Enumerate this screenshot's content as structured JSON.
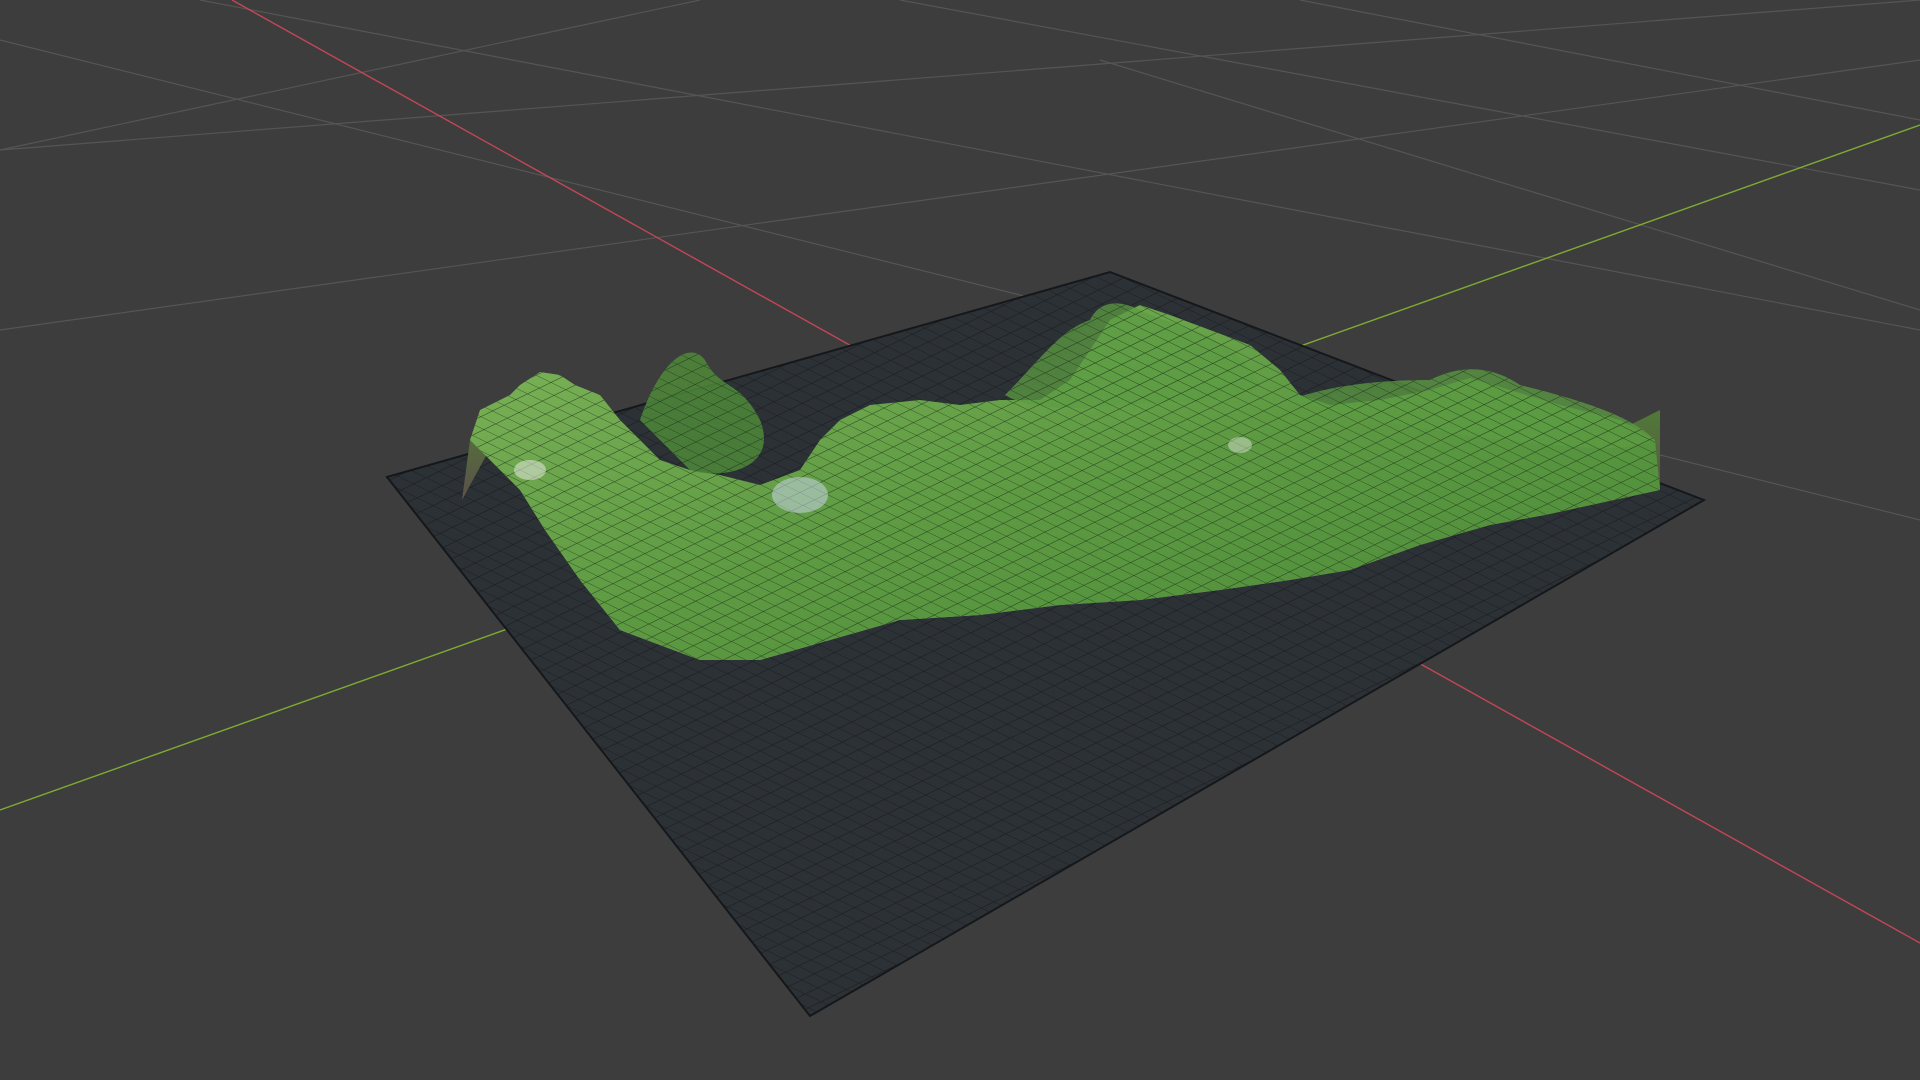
{
  "viewport": {
    "background_color": "#3d3d3d",
    "floor_grid_color": "#555555",
    "x_axis_color": "#d9485b",
    "y_axis_color": "#8bbd31"
  },
  "terrain": {
    "base_plane_color": "#2c3136",
    "base_plane_wire_color": "#1a1d20",
    "surface_color": "#5d9a42",
    "surface_light_color": "#8cc55a",
    "cliff_color": "#6b6256",
    "cliff_light_color": "#c9c3b3",
    "wireframe_color": "#1b2a17"
  }
}
